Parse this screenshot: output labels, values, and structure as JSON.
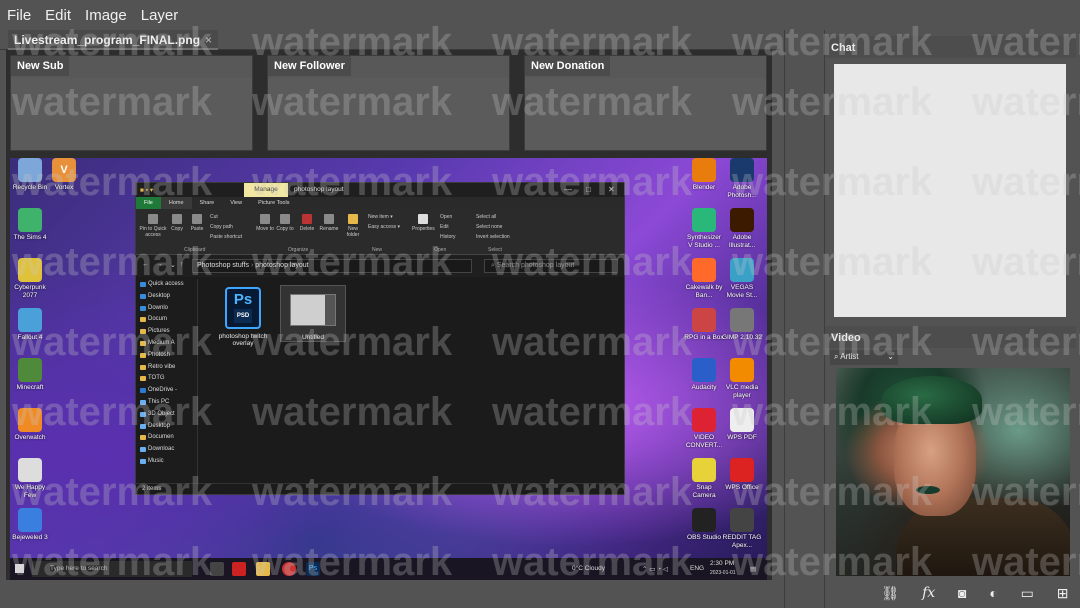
{
  "menu": {
    "file": "File",
    "edit": "Edit",
    "image": "Image",
    "layer": "Layer"
  },
  "document": {
    "tab_title": "Livestream_program_FINAL.png",
    "close": "×"
  },
  "alerts": {
    "new_sub": "New Sub",
    "new_follower": "New Follower",
    "new_donation": "New Donation"
  },
  "panels": {
    "chat": "Chat",
    "video": "Video",
    "video_dropdown": "Artist",
    "dropdown_caret": "⌄"
  },
  "watermark_text": "watermark",
  "desktop_icons_left": [
    {
      "label": "Recycle Bin",
      "icon": "recycle-bin-icon",
      "color": "#7da7d9"
    },
    {
      "label": "The Sims 4",
      "icon": "sims-icon",
      "color": "#3fb36b"
    },
    {
      "label": "Cyberpunk 2077",
      "icon": "cyberpunk-icon",
      "color": "#e0c23a"
    },
    {
      "label": "Fallout 4",
      "icon": "fallout-icon",
      "color": "#4aa0d8"
    },
    {
      "label": "Minecraft",
      "icon": "minecraft-icon",
      "color": "#4e8a3a"
    },
    {
      "label": "Overwatch",
      "icon": "overwatch-icon",
      "color": "#f08a24"
    },
    {
      "label": "We Happy Few",
      "icon": "we-happy-few-icon",
      "color": "#dddddd"
    },
    {
      "label": "Bejeweled 3",
      "icon": "bejeweled-icon",
      "color": "#3a7ee0"
    }
  ],
  "desktop_icons_col2": [
    {
      "label": "Vortex",
      "icon": "vortex-icon",
      "color": "#e8903a"
    }
  ],
  "desktop_icons_right": [
    {
      "label": "Blender",
      "icon": "blender-icon",
      "color": "#e87d0d"
    },
    {
      "label": "Adobe Photosh...",
      "icon": "photoshop-icon",
      "color": "#1a3a6e"
    },
    {
      "label": "Synthesizer V Studio ...",
      "icon": "synthesizer-icon",
      "color": "#2ab87a"
    },
    {
      "label": "Adobe Illustrat...",
      "icon": "illustrator-icon",
      "color": "#3b1a00"
    },
    {
      "label": "Cakewalk by Ban...",
      "icon": "cakewalk-icon",
      "color": "#ff6a2a"
    },
    {
      "label": "VEGAS Movie St...",
      "icon": "vegas-icon",
      "color": "#3aa0c8"
    },
    {
      "label": "RPG in a Box",
      "icon": "rpg-in-a-box-icon",
      "color": "#c44"
    },
    {
      "label": "GIMP 2.10.32",
      "icon": "gimp-icon",
      "color": "#777"
    },
    {
      "label": "Audacity",
      "icon": "audacity-icon",
      "color": "#2a5fc9"
    },
    {
      "label": "VLC media player",
      "icon": "vlc-icon",
      "color": "#f28b00"
    },
    {
      "label": "VIDEO CONVERT...",
      "icon": "video-convert-icon",
      "color": "#d23"
    },
    {
      "label": "WPS PDF",
      "icon": "wps-pdf-icon",
      "color": "#eee"
    },
    {
      "label": "Snap Camera",
      "icon": "snap-camera-icon",
      "color": "#e8d23a"
    },
    {
      "label": "WPS Office",
      "icon": "wps-office-icon",
      "color": "#d22"
    },
    {
      "label": "OBS Studio",
      "icon": "obs-icon",
      "color": "#222"
    },
    {
      "label": "REDDIT TAG Apex...",
      "icon": "reddit-tag-icon",
      "color": "#444"
    }
  ],
  "explorer": {
    "manage": "Manage",
    "title": "photoshop layout",
    "tabs": [
      "File",
      "Home",
      "Share",
      "View",
      "Picture Tools"
    ],
    "ribbon": {
      "pin": "Pin to Quick access",
      "copy": "Copy",
      "paste": "Paste",
      "cut": "Cut",
      "copy_path": "Copy path",
      "paste_shortcut": "Paste shortcut",
      "move_to": "Move to",
      "copy_to": "Copy to",
      "delete": "Delete",
      "rename": "Rename",
      "new_folder": "New folder",
      "new_item": "New item ▾",
      "easy_access": "Easy access ▾",
      "properties": "Properties",
      "open": "Open",
      "edit": "Edit",
      "history": "History",
      "select_all": "Select all",
      "select_none": "Select none",
      "invert_selection": "Invert selection",
      "groups": [
        "Clipboard",
        "Organize",
        "New",
        "Open",
        "Select"
      ]
    },
    "breadcrumb": [
      "Photoshop stuffs",
      "photoshop layout"
    ],
    "search_placeholder": "Search photoshop layout",
    "nav": [
      {
        "label": "Quick access",
        "kind": "blue"
      },
      {
        "label": "Desktop",
        "kind": "blue"
      },
      {
        "label": "Downlo",
        "kind": "blue"
      },
      {
        "label": "Docum",
        "kind": ""
      },
      {
        "label": "Pictures",
        "kind": ""
      },
      {
        "label": "Medium A",
        "kind": ""
      },
      {
        "label": "Photosh",
        "kind": ""
      },
      {
        "label": "Retro vibe",
        "kind": ""
      },
      {
        "label": "TOTG",
        "kind": ""
      },
      {
        "label": "OneDrive -",
        "kind": "cloud"
      },
      {
        "label": "This PC",
        "kind": "pc"
      },
      {
        "label": "3D Object",
        "kind": "pc"
      },
      {
        "label": "Desktop",
        "kind": "pc"
      },
      {
        "label": "Documen",
        "kind": ""
      },
      {
        "label": "Downloac",
        "kind": "pc"
      },
      {
        "label": "Music",
        "kind": "pc"
      }
    ],
    "files": [
      {
        "name": "photoshop twitch overlay",
        "badge": "Ps",
        "ext": "PSD"
      },
      {
        "name": "Untitled"
      }
    ],
    "status": "2 items"
  },
  "taskbar": {
    "search_placeholder": "Type here to search",
    "weather": "0°C  Cloudy",
    "lang": "ENG",
    "time": "2:30 PM",
    "date": "2023-01-01"
  }
}
